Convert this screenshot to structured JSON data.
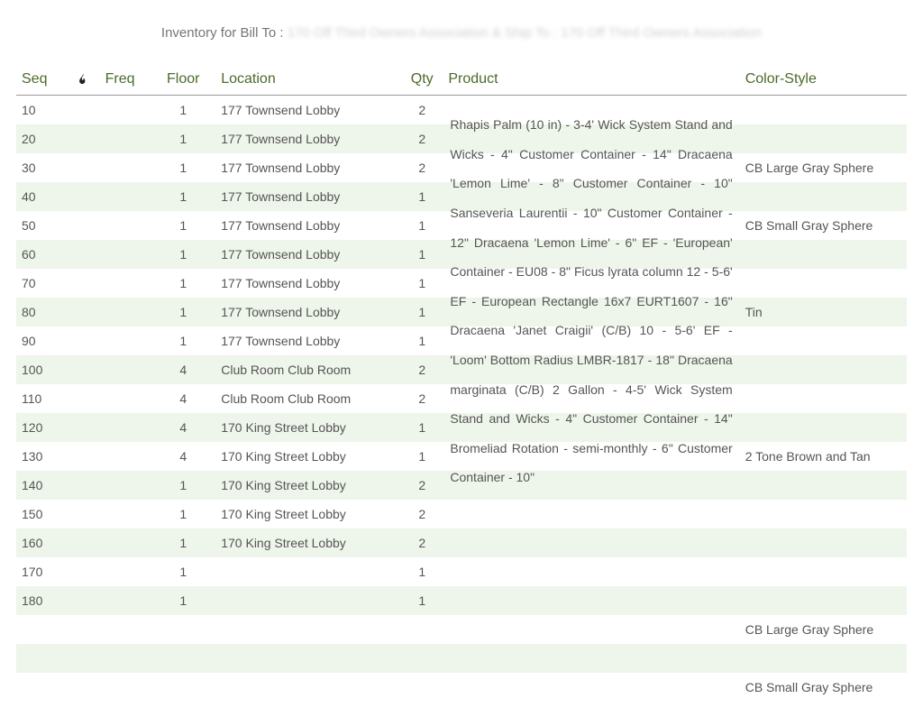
{
  "title_prefix": "Inventory for Bill To : ",
  "title_blurred": "170 Off Third Owners Association & Ship To : 170 Off Third Owners Association",
  "headers": {
    "seq": "Seq",
    "freq": "Freq",
    "floor": "Floor",
    "location": "Location",
    "qty": "Qty",
    "product": "Product",
    "color_style": "Color-Style"
  },
  "product_flow_text": "Rhapis Palm (10 in) - 3-4' Wick System Stand and Wicks - 4\" Customer Container - 14\" Dracaena 'Lemon Lime' - 8\" Customer Container - 10\" Sanseveria Laurentii - 10\" Customer Container - 12\" Dracaena 'Lemon Lime' - 6\" EF - 'European' Container - EU08 - 8\" Ficus lyrata column 12 - 5-6' EF - European Rectangle 16x7 EURT1607 - 16\" Dracaena 'Janet Craigii' (C/B) 10 - 5-6' EF - 'Loom' Bottom Radius LMBR-1817 - 18\" Dracaena marginata (C/B) 2 Gallon - 4-5' Wick System Stand and Wicks - 4\" Customer Container - 14\" Bromeliad Rotation - semi-monthly - 6\" Customer Container - 10\"",
  "rows": [
    {
      "seq": "10",
      "floor": "1",
      "location": "177 Townsend Lobby",
      "qty": "2",
      "color_style": ""
    },
    {
      "seq": "20",
      "floor": "1",
      "location": "177 Townsend Lobby",
      "qty": "2",
      "color_style": ""
    },
    {
      "seq": "30",
      "floor": "1",
      "location": "177 Townsend Lobby",
      "qty": "2",
      "color_style": "CB Large Gray Sphere"
    },
    {
      "seq": "40",
      "floor": "1",
      "location": "177 Townsend Lobby",
      "qty": "1",
      "color_style": ""
    },
    {
      "seq": "50",
      "floor": "1",
      "location": "177 Townsend Lobby",
      "qty": "1",
      "color_style": "CB Small Gray Sphere"
    },
    {
      "seq": "60",
      "floor": "1",
      "location": "177 Townsend Lobby",
      "qty": "1",
      "color_style": ""
    },
    {
      "seq": "70",
      "floor": "1",
      "location": "177 Townsend Lobby",
      "qty": "1",
      "color_style": ""
    },
    {
      "seq": "80",
      "floor": "1",
      "location": "177 Townsend Lobby",
      "qty": "1",
      "color_style": "Tin"
    },
    {
      "seq": "90",
      "floor": "1",
      "location": "177 Townsend Lobby",
      "qty": "1",
      "color_style": ""
    },
    {
      "seq": "100",
      "floor": "4",
      "location": "Club Room Club Room",
      "qty": "2",
      "color_style": ""
    },
    {
      "seq": "110",
      "floor": "4",
      "location": "Club Room Club Room",
      "qty": "2",
      "color_style": ""
    },
    {
      "seq": "120",
      "floor": "4",
      "location": "170 King Street Lobby",
      "qty": "1",
      "color_style": ""
    },
    {
      "seq": "130",
      "floor": "4",
      "location": "170 King Street Lobby",
      "qty": "1",
      "color_style": "2 Tone Brown and Tan"
    },
    {
      "seq": "140",
      "floor": "1",
      "location": "170 King Street Lobby",
      "qty": "2",
      "color_style": ""
    },
    {
      "seq": "150",
      "floor": "1",
      "location": "170 King Street Lobby",
      "qty": "2",
      "color_style": ""
    },
    {
      "seq": "160",
      "floor": "1",
      "location": "170 King Street Lobby",
      "qty": "2",
      "color_style": ""
    },
    {
      "seq": "170",
      "floor": "1",
      "location": "",
      "qty": "1",
      "color_style": ""
    },
    {
      "seq": "180",
      "floor": "1",
      "location": "",
      "qty": "1",
      "color_style": ""
    },
    {
      "seq": "",
      "floor": "",
      "location": "",
      "qty": "",
      "color_style": "CB Large Gray Sphere"
    },
    {
      "seq": "",
      "floor": "",
      "location": "",
      "qty": "",
      "color_style": ""
    },
    {
      "seq": "",
      "floor": "",
      "location": "",
      "qty": "",
      "color_style": "CB Small Gray Sphere"
    }
  ]
}
